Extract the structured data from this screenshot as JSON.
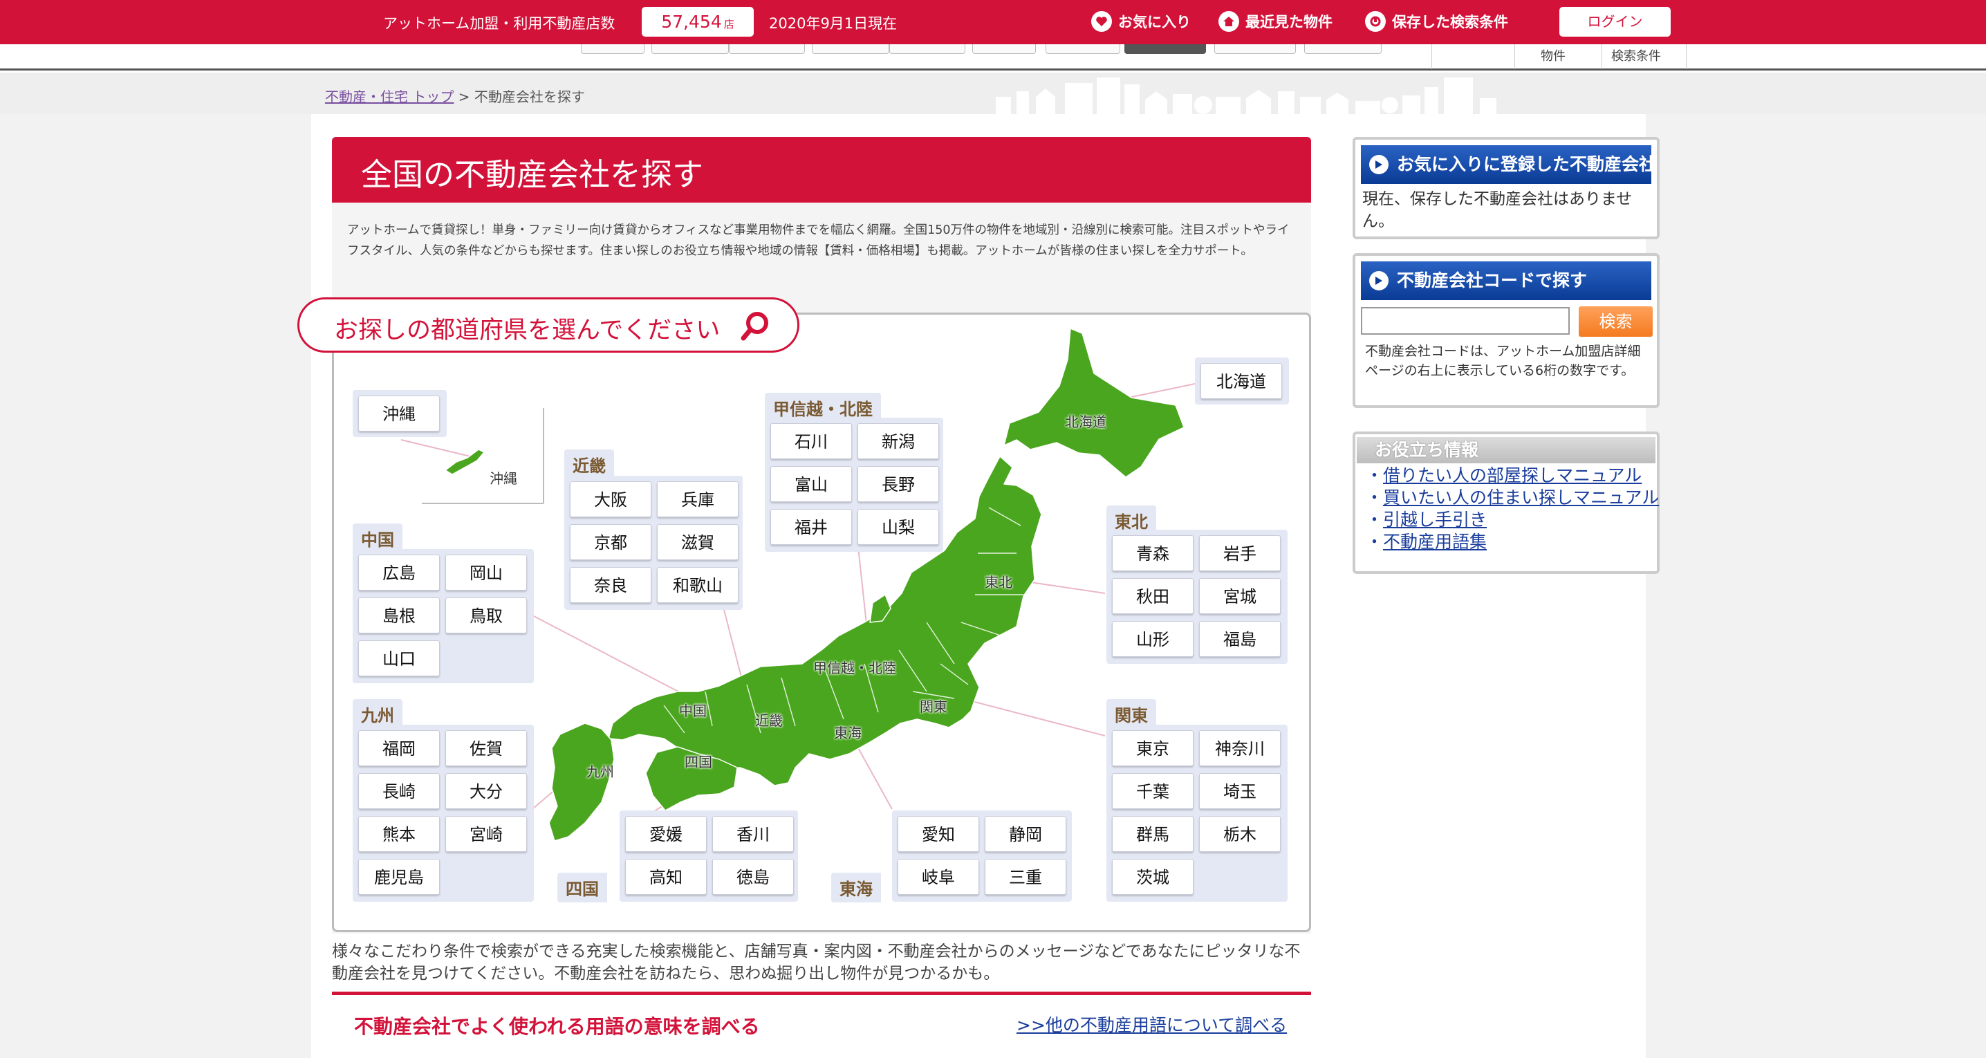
{
  "topbar": {
    "member_label": "アットホーム加盟・利用不動産店数",
    "count": "57,454",
    "count_unit": "店",
    "as_of": "2020年9月1日現在",
    "nav": [
      {
        "label": "お気に入り",
        "icon": "heart-icon"
      },
      {
        "label": "最近見た物件",
        "icon": "house-icon"
      },
      {
        "label": "保存した検索条件",
        "icon": "save-icon"
      }
    ],
    "login_label": "ログイン"
  },
  "subnav": {
    "items": [
      "物件",
      "検索条件"
    ]
  },
  "breadcrumb": {
    "home": "不動産・住宅 トップ",
    "separator": ">",
    "current": "不動産会社を探す"
  },
  "main": {
    "title": "全国の不動産会社を探す",
    "intro": "アットホームで賃貸探し！単身・ファミリー向け賃貸からオフィスなど事業用物件までを幅広く網羅。全国150万件の物件を地域別・沿線別に検索可能。注目スポットやライフスタイル、人気の条件などからも探せます。住まい探しのお役立ち情報や地域の情報【賃料・価格相場】も掲載。アットホームが皆様の住まい探しを全力サポート。",
    "prompt": "お探しの都道府県を選んでください",
    "bottom_text": "様々なこだわり条件で検索ができる充実した検索機能と、店舗写真・案内図・不動産会社からのメッセージなどであなたにピッタリな不動産会社を見つけてください。不動産会社を訪ねたら、思わぬ掘り出し物件が見つかるかも。",
    "terms_heading": "不動産会社でよく使われる用語の意味を調べる",
    "terms_link": ">>他の不動産用語について調べる"
  },
  "map_labels": {
    "hokkaido": "北海道",
    "tohoku": "東北",
    "koshinetsu": "甲信越・北陸",
    "kanto": "関東",
    "tokai": "東海",
    "kinki": "近畿",
    "chugoku": "中国",
    "shikoku": "四国",
    "kyushu": "九州",
    "okinawa": "沖縄"
  },
  "regions": {
    "okinawa": {
      "prefs": [
        "沖縄"
      ]
    },
    "hokkaido": {
      "prefs": [
        "北海道"
      ]
    },
    "kinki": {
      "name": "近畿",
      "prefs": [
        "大阪",
        "兵庫",
        "京都",
        "滋賀",
        "奈良",
        "和歌山"
      ]
    },
    "koshinetsu": {
      "name": "甲信越・北陸",
      "prefs": [
        "石川",
        "新潟",
        "富山",
        "長野",
        "福井",
        "山梨"
      ]
    },
    "chugoku": {
      "name": "中国",
      "prefs": [
        "広島",
        "岡山",
        "島根",
        "鳥取",
        "山口"
      ]
    },
    "tohoku": {
      "name": "東北",
      "prefs": [
        "青森",
        "岩手",
        "秋田",
        "宮城",
        "山形",
        "福島"
      ]
    },
    "kyushu": {
      "name": "九州",
      "prefs": [
        "福岡",
        "佐賀",
        "長崎",
        "大分",
        "熊本",
        "宮崎",
        "鹿児島"
      ]
    },
    "kanto": {
      "name": "関東",
      "prefs": [
        "東京",
        "神奈川",
        "千葉",
        "埼玉",
        "群馬",
        "栃木",
        "茨城"
      ]
    },
    "shikoku": {
      "name": "四国",
      "prefs": [
        "愛媛",
        "香川",
        "高知",
        "徳島"
      ]
    },
    "tokai": {
      "name": "東海",
      "prefs": [
        "愛知",
        "静岡",
        "岐阜",
        "三重"
      ]
    }
  },
  "sidebar": {
    "favorites_title": "お気に入りに登録した不動産会社",
    "favorites_empty": "現在、保存した不動産会社はありません。",
    "code_title": "不動産会社コードで探す",
    "code_button": "検索",
    "code_note": "不動産会社コードは、アットホーム加盟店詳細ページの右上に表示している6桁の数字です。",
    "guide_title": "お役立ち情報",
    "guide_links": [
      "借りたい人の部屋探しマニュアル",
      "買いたい人の住まい探しマニュアル",
      "引越し手引き",
      "不動産用語集"
    ]
  },
  "colors": {
    "brand_red": "#d3123a",
    "map_green": "#4aa61e",
    "sidebar_blue": "#0a3b95",
    "search_orange": "#f47b20"
  }
}
